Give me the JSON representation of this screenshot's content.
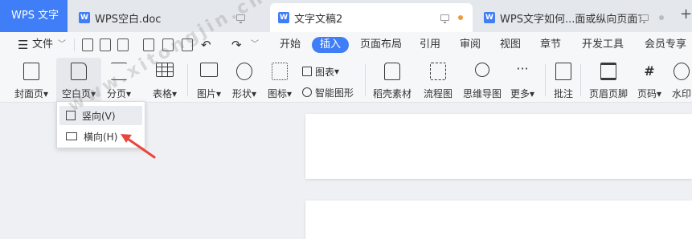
{
  "titlebar": {
    "app_name": "WPS 文字",
    "tabs": [
      {
        "label": "WPS空白.doc",
        "active": false
      },
      {
        "label": "文字文稿2",
        "active": true
      },
      {
        "label": "WPS文字如何...面或纵向页面?",
        "active": false
      }
    ],
    "new_tab_label": "+"
  },
  "menubar": {
    "file_label": "文件",
    "items": [
      "开始",
      "插入",
      "页面布局",
      "引用",
      "审阅",
      "视图",
      "章节",
      "开发工具",
      "会员专享"
    ],
    "active_item": "插入"
  },
  "ribbon": {
    "cover_label": "封面页",
    "blank_page_label": "空白页",
    "page_break_label": "分页",
    "table_label": "表格",
    "picture_label": "图片",
    "shape_label": "形状",
    "icon_label": "图标",
    "chart_label": "图表",
    "smart_art_label": "智能图形",
    "docer_material_label": "稻壳素材",
    "flowchart_label": "流程图",
    "mindmap_label": "思维导图",
    "more_label": "更多",
    "comment_label": "批注",
    "header_footer_label": "页眉页脚",
    "page_number_label": "页码",
    "watermark_label": "水印"
  },
  "dropdown": {
    "items": [
      {
        "label": "竖向(V)",
        "icon": "portrait-page-icon",
        "hovered": true
      },
      {
        "label": "横向(H)",
        "icon": "landscape-page-icon",
        "hovered": false
      }
    ]
  },
  "overlay": {
    "watermark_text": "www.xitongjin.cn"
  },
  "colors": {
    "accent": "#3f7ef6",
    "arrow": "#e8453c",
    "unsaved_dot": "#ec9a3a"
  }
}
